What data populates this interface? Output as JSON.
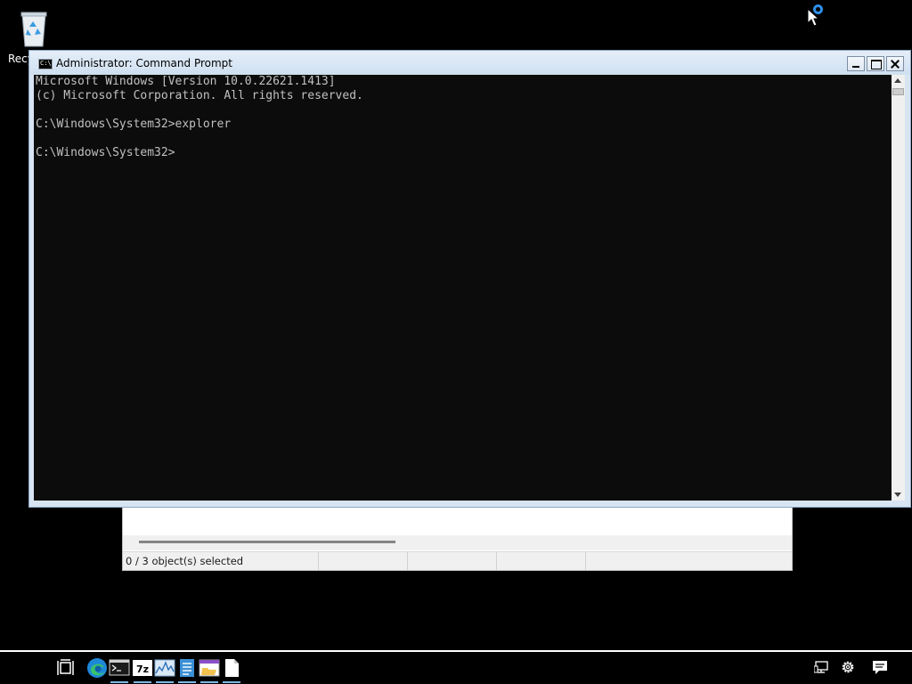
{
  "desktop": {
    "recycle_bin_label": "Recy"
  },
  "cmd_window": {
    "title": "Administrator:  Command Prompt",
    "lines": [
      "Microsoft Windows [Version 10.0.22621.1413]",
      "(c) Microsoft Corporation. All rights reserved.",
      "C:\\Windows\\System32>explorer",
      "C:\\Windows\\System32>"
    ]
  },
  "explorer_window": {
    "status_text": "0 / 3 object(s) selected"
  },
  "taskbar": {
    "items": [
      "task-view-icon",
      "edge-icon",
      "command-prompt-icon",
      "7zip-icon",
      "performance-monitor-icon",
      "notepad-icon",
      "explorer-icon",
      "document-icon"
    ],
    "tray": [
      "network-icon",
      "settings-icon",
      "notifications-icon"
    ]
  },
  "colors": {
    "console_bg": "#0c0c0c",
    "console_fg": "#c0c0c0",
    "titlebar": "#d7e4f2",
    "taskbar_bg": "#000000",
    "accent": "#2f8fe8"
  }
}
